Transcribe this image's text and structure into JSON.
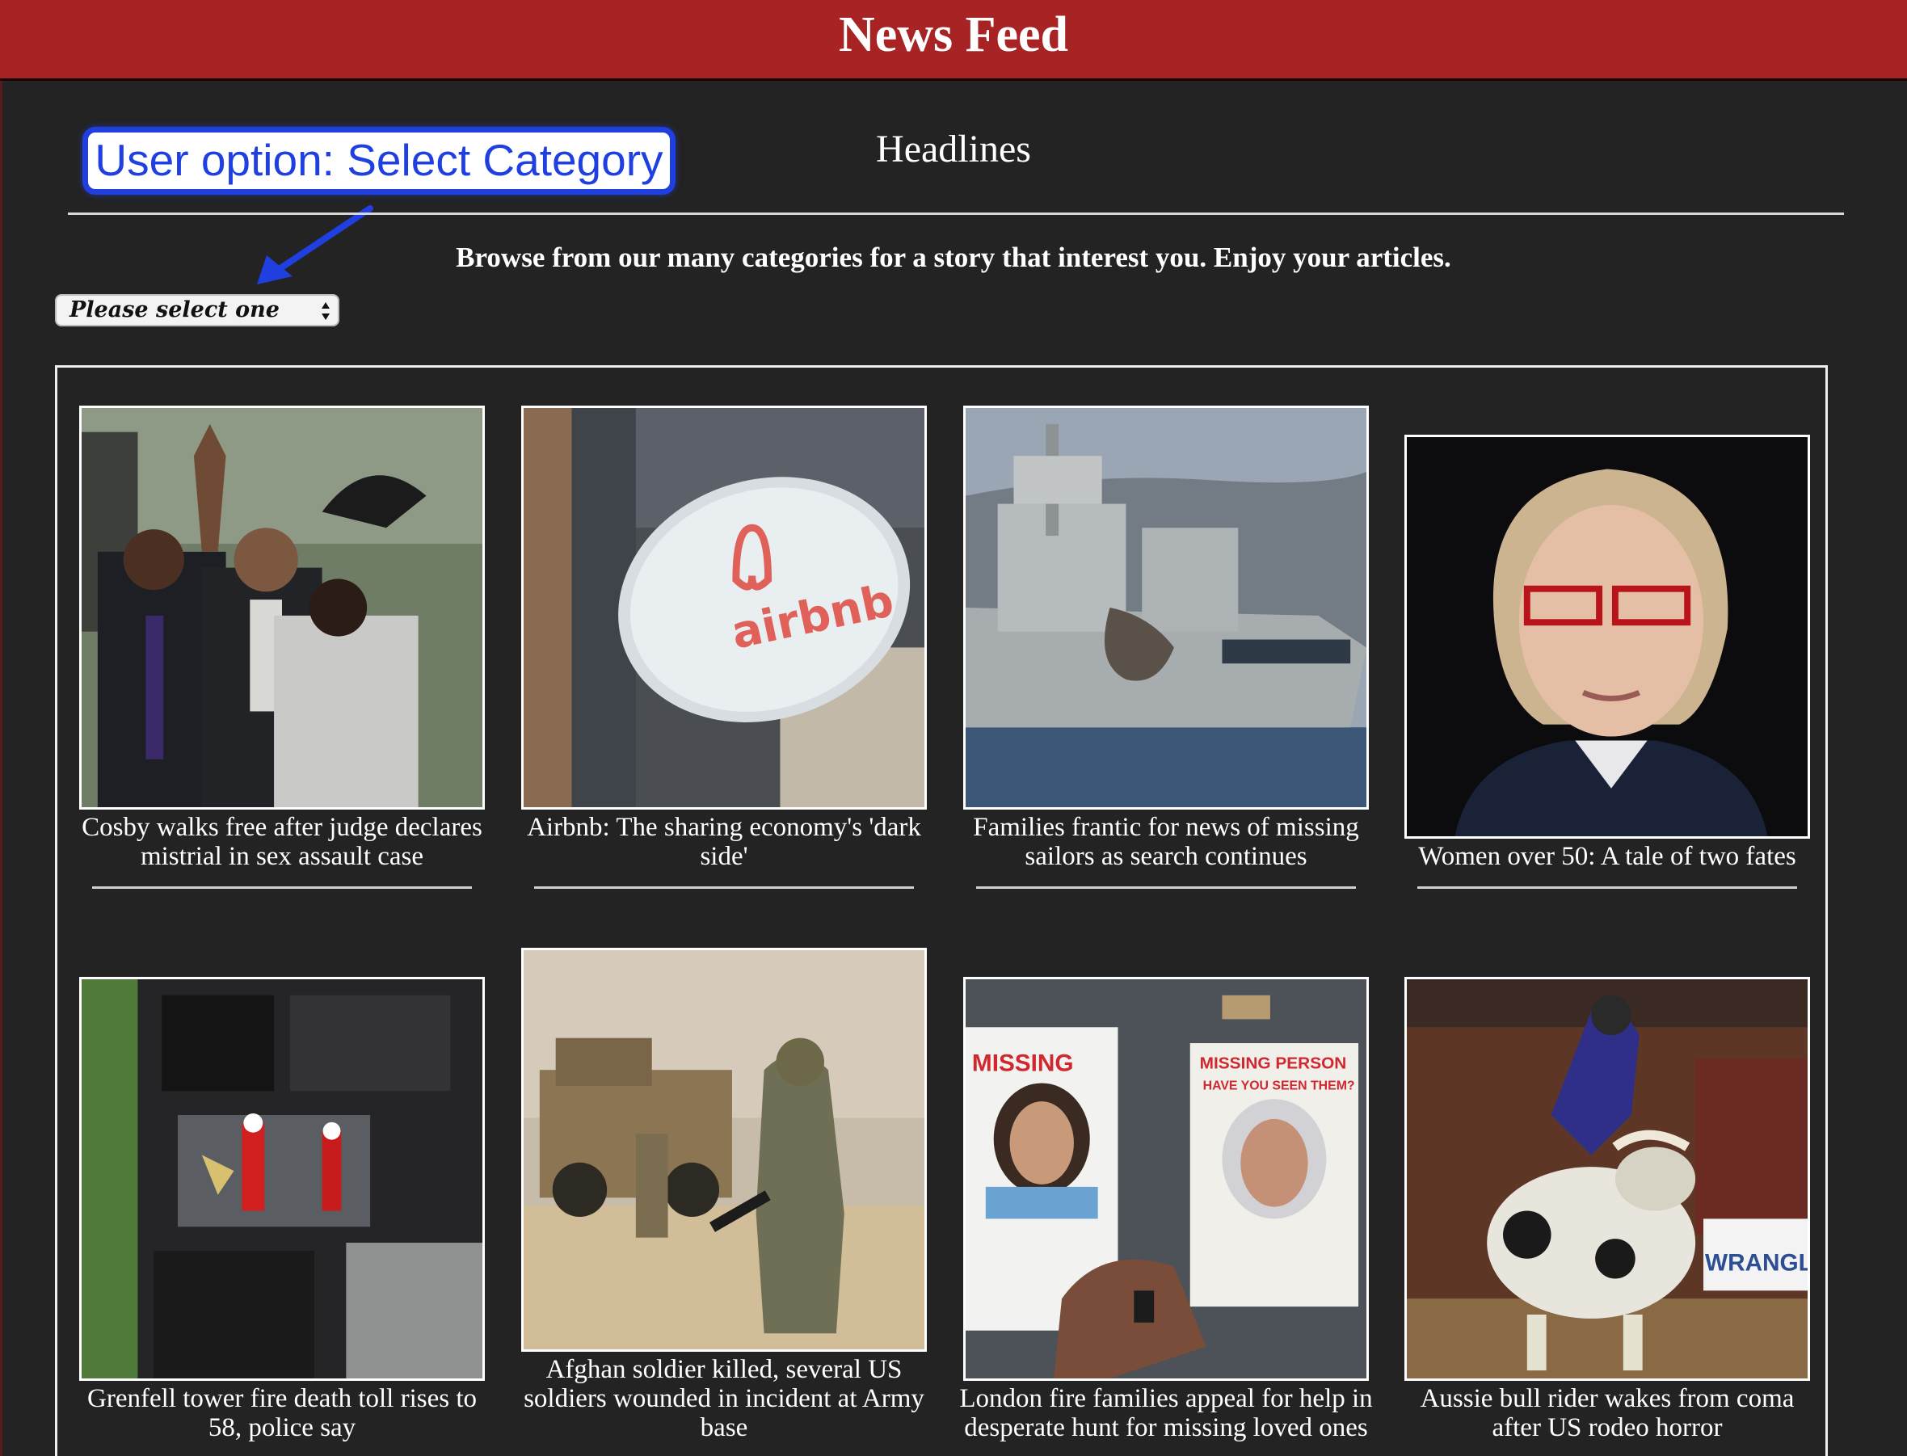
{
  "header": {
    "title": "News Feed"
  },
  "annotation": {
    "callout_text": "User option: Select Category"
  },
  "section": {
    "title": "Headlines",
    "tagline": "Browse from our many categories for a story that interest you. Enjoy your articles."
  },
  "category_select": {
    "selected": "Please select one"
  },
  "colors": {
    "header_bg": "#a82424",
    "page_bg": "#232323",
    "callout_blue": "#1f3fe0",
    "text": "#ffffff"
  },
  "articles": [
    {
      "caption": "Cosby walks free after judge declares mistrial in sex assault case"
    },
    {
      "caption": "Airbnb: The sharing economy's 'dark side'",
      "logo_text": "airbnb"
    },
    {
      "caption": "Families frantic for news of missing sailors as search continues"
    },
    {
      "caption": "Women over 50: A tale of two fates"
    },
    {
      "caption": "Grenfell tower fire death toll rises to 58, police say"
    },
    {
      "caption": "Afghan soldier killed, several US soldiers wounded in incident at Army base"
    },
    {
      "caption": "London fire families appeal for help in desperate hunt for missing loved ones",
      "poster_left": "MISSING",
      "poster_right_1": "MISSING PERSON",
      "poster_right_2": "HAVE YOU SEEN THEM?"
    },
    {
      "caption": "Aussie bull rider wakes from coma after US rodeo horror",
      "banner_text": "WRANGLE"
    }
  ]
}
